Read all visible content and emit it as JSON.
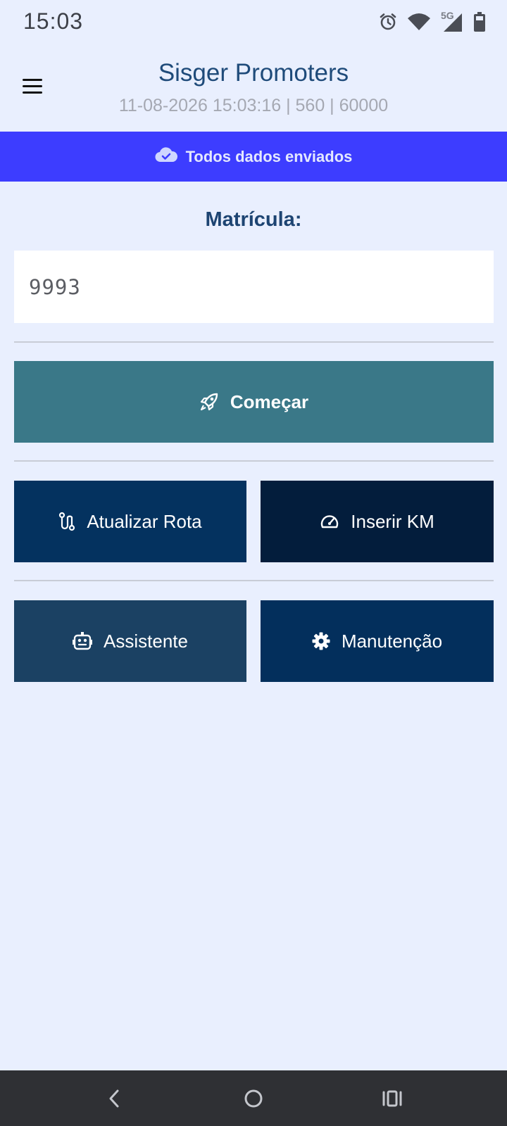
{
  "status_bar": {
    "time": "15:03",
    "network_label": "5G",
    "icons": [
      "alarm-icon",
      "wifi-icon",
      "signal-icon",
      "battery-icon"
    ]
  },
  "header": {
    "title": "Sisger Promoters",
    "subtitle": "11-08-2026 15:03:16 | 560 | 60000"
  },
  "sync_banner": {
    "icon": "cloud-check-icon",
    "text": "Todos dados enviados",
    "color": "#3d3dff"
  },
  "form": {
    "label": "Matrícula:",
    "matricula_value": "9993"
  },
  "buttons": {
    "start": {
      "label": "Começar",
      "icon": "rocket-icon",
      "color": "#3a7888"
    },
    "update_route": {
      "label": "Atualizar Rota",
      "icon": "route-icon",
      "color": "#04325f"
    },
    "insert_km": {
      "label": "Inserir KM",
      "icon": "gauge-icon",
      "color": "#031d3c"
    },
    "assistant": {
      "label": "Assistente",
      "icon": "robot-icon",
      "color": "#1b4163"
    },
    "maintenance": {
      "label": "Manutenção",
      "icon": "gear-icon",
      "color": "#032f5c"
    }
  },
  "nav_bar": {
    "items": [
      "back-icon",
      "home-icon",
      "recents-icon"
    ]
  }
}
